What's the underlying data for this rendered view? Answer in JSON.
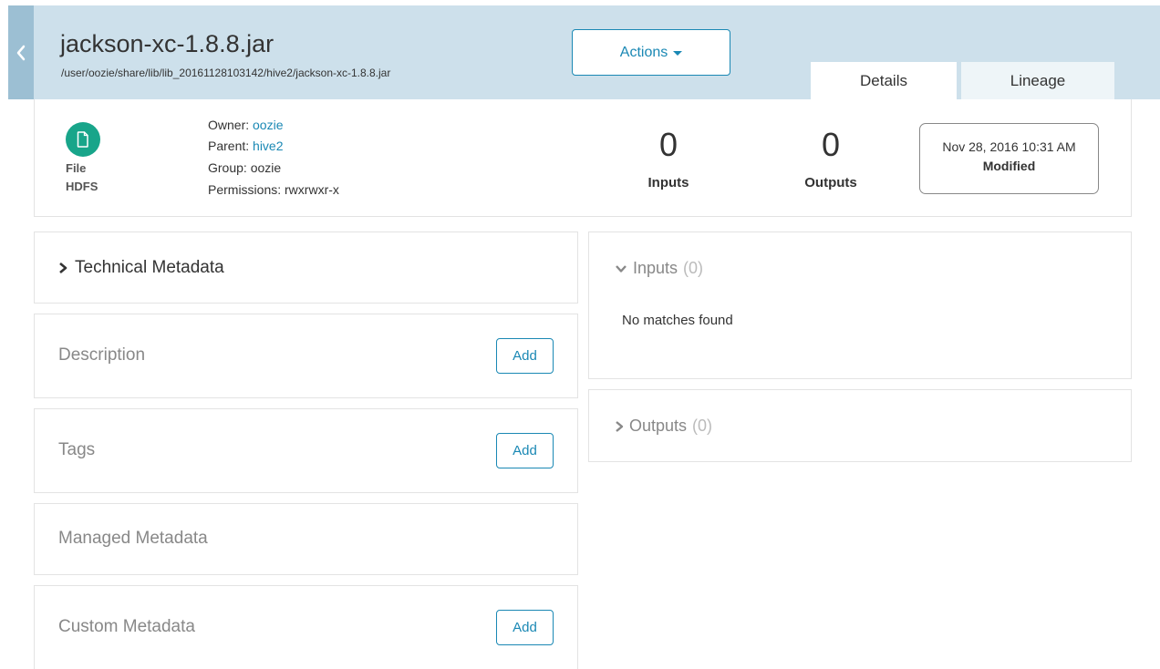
{
  "header": {
    "title": "jackson-xc-1.8.8.jar",
    "path": "/user/oozie/share/lib/lib_20161128103142/hive2/jackson-xc-1.8.8.jar",
    "actions_label": "Actions",
    "tabs": [
      {
        "label": "Details",
        "active": true
      },
      {
        "label": "Lineage",
        "active": false
      }
    ]
  },
  "summary": {
    "type": "File",
    "source": "HDFS",
    "owner_label": "Owner:",
    "owner": "oozie",
    "parent_label": "Parent:",
    "parent": "hive2",
    "group": "Group: oozie",
    "permissions": "Permissions: rwxrwxr-x",
    "inputs_count": "0",
    "inputs_label": "Inputs",
    "outputs_count": "0",
    "outputs_label": "Outputs",
    "modified_date": "Nov 28, 2016 10:31 AM",
    "modified_label": "Modified"
  },
  "left_cards": {
    "technical_metadata": "Technical Metadata",
    "description": "Description",
    "tags": "Tags",
    "managed_metadata": "Managed Metadata",
    "custom_metadata": "Custom Metadata",
    "add_label": "Add"
  },
  "right_panels": {
    "inputs_title": "Inputs",
    "inputs_count": "(0)",
    "inputs_empty": "No matches found",
    "outputs_title": "Outputs",
    "outputs_count": "(0)"
  },
  "colors": {
    "header_bg": "#cde0eb",
    "accent": "#1a88b4",
    "file_icon": "#18a58a"
  }
}
